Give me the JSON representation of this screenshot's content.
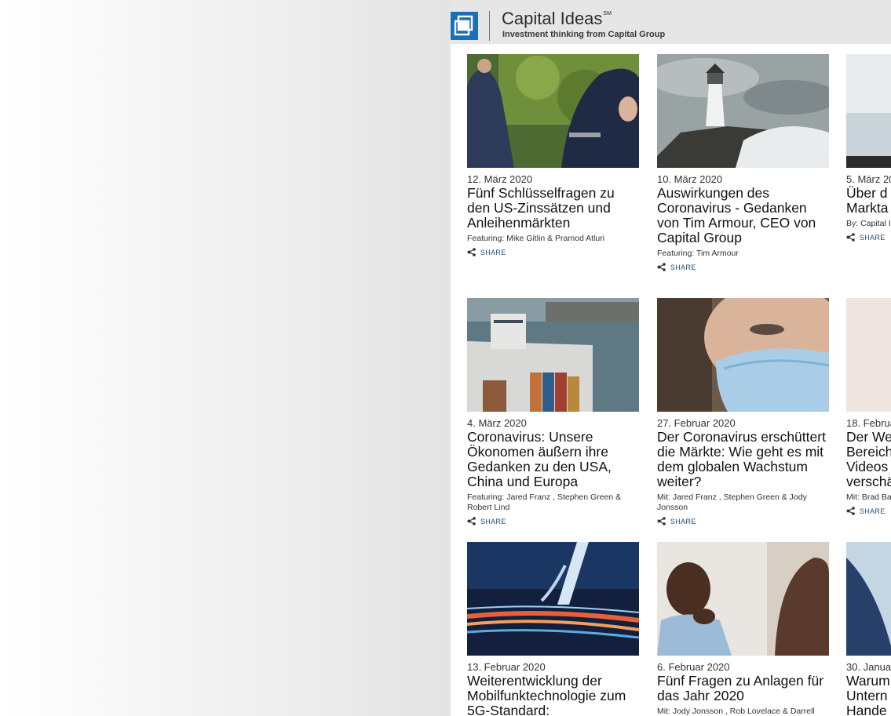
{
  "header": {
    "title": "Capital Ideas",
    "superscript": "SM",
    "subtitle": "Investment thinking from Capital Group"
  },
  "colors": {
    "brand_blue": "#1b6fb5",
    "share_blue": "#1f4d7a",
    "header_bg": "#e6e6e6"
  },
  "share_label": "SHARE",
  "cards": [
    {
      "date": "12. März 2020",
      "title": "Fünf Schlüsselfragen zu den US-Zinssätzen und Anleihenmärkten",
      "author": "Featuring: Mike Gitlin & Pramod Atluri",
      "image": "hikers-in-rain"
    },
    {
      "date": "10. März 2020",
      "title": "Auswirkungen des Coronavirus - Gedanken von Tim Armour, CEO von Capital Group",
      "author": "Featuring: Tim Armour",
      "image": "lighthouse-waves"
    },
    {
      "date": "5. März 20",
      "title": "Über d",
      "title2": "Markta",
      "author": "By: Capital I",
      "image": "office"
    },
    {
      "date": "4. März 2020",
      "title": "Coronavirus: Unsere Ökonomen äußern ihre Gedanken zu den USA, China und Europa",
      "author": "Featuring: Jared Franz , Stephen Green & Robert Lind",
      "image": "container-ship"
    },
    {
      "date": "27. Februar 2020",
      "title": "Der Coronavirus erschüttert die Märkte: Wie geht es mit dem globalen Wachstum weiter?",
      "author": "Mit: Jared Franz , Stephen Green & Jody Jonsson",
      "image": "woman-face-mask"
    },
    {
      "date": "18. Februa",
      "title": "Der We",
      "title2": "Bereich",
      "title3": "Videos",
      "title4": "verschä",
      "author": "Mit: Brad Ba",
      "image": "blurred"
    },
    {
      "date": "13. Februar 2020",
      "title": "Weiterentwicklung der Mobilfunktechnologie zum 5G-Standard:",
      "author": "",
      "image": "5g-light-trails"
    },
    {
      "date": "6. Februar 2020",
      "title": "Fünf Fragen zu Anlagen für das Jahr 2020",
      "author": "Mit: Jody Jonsson , Rob Lovelace & Darrell",
      "image": "thinking-man"
    },
    {
      "date": "30. Januar",
      "title": "Warum",
      "title2": "Untern",
      "title3": "Hande",
      "author": "",
      "image": "ship-bow"
    }
  ]
}
